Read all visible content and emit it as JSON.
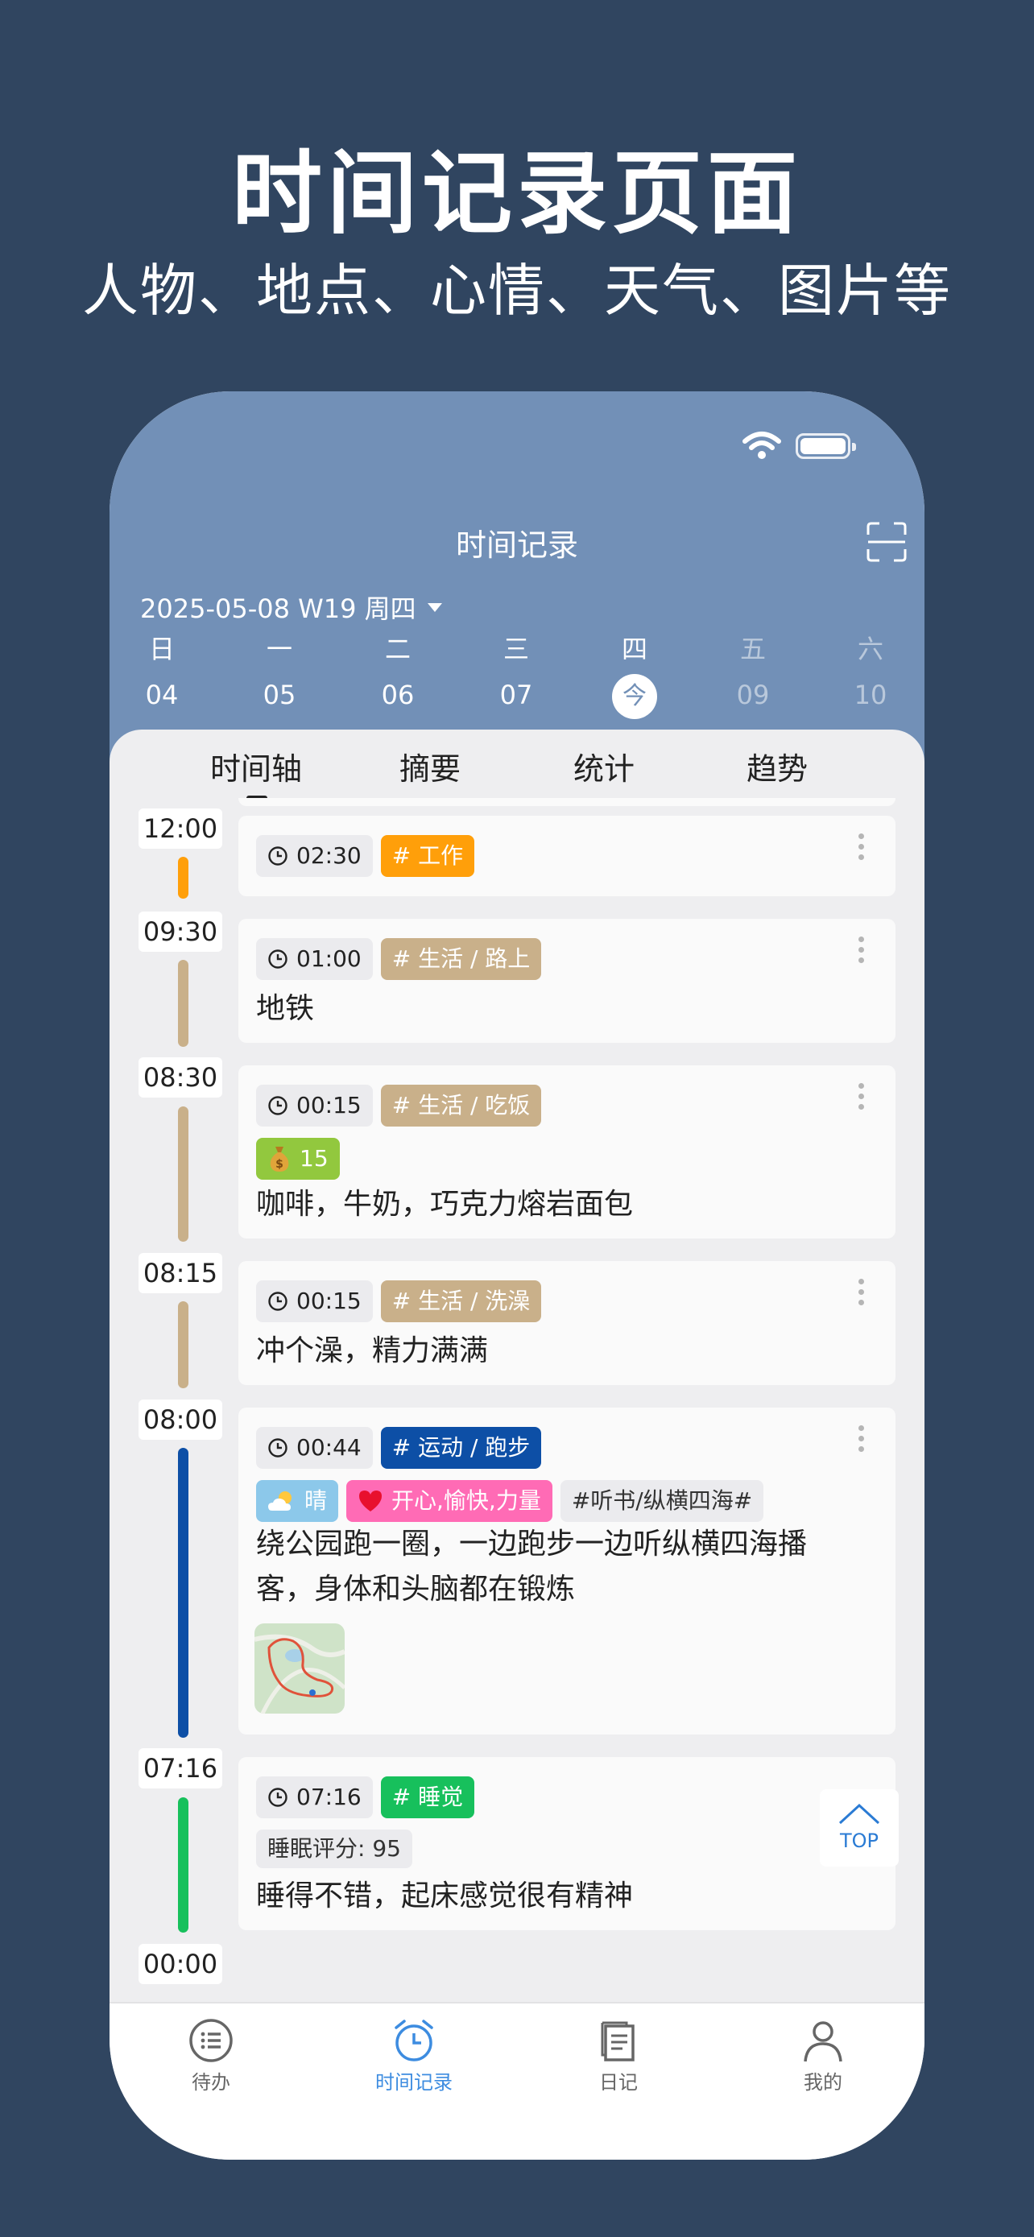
{
  "promo": {
    "title": "时间记录页面",
    "subtitle": "人物、地点、心情、天气、图片等"
  },
  "header": {
    "title": "时间记录",
    "date_selector": "2025-05-08 W19 周四"
  },
  "week": [
    {
      "weekday": "日",
      "date": "04"
    },
    {
      "weekday": "一",
      "date": "05"
    },
    {
      "weekday": "二",
      "date": "06"
    },
    {
      "weekday": "三",
      "date": "07"
    },
    {
      "weekday": "四",
      "date": "今"
    },
    {
      "weekday": "五",
      "date": "09"
    },
    {
      "weekday": "六",
      "date": "10"
    }
  ],
  "tabs": [
    "时间轴",
    "摘要",
    "统计",
    "趋势"
  ],
  "timeline": {
    "times": [
      "12:00",
      "09:30",
      "08:30",
      "08:15",
      "08:00",
      "07:16",
      "00:00"
    ],
    "entries": [
      {
        "duration": "02:30",
        "tag": "# 工作",
        "color": "#ff9f0a"
      },
      {
        "duration": "01:00",
        "tag": "# 生活 / 路上",
        "color": "#c9b08a",
        "note": "地铁"
      },
      {
        "duration": "00:15",
        "tag": "# 生活 / 吃饭",
        "color": "#c9b08a",
        "expense": "15",
        "expense_color": "#92c83e",
        "note": "咖啡，牛奶，巧克力熔岩面包"
      },
      {
        "duration": "00:15",
        "tag": "# 生活 / 洗澡",
        "color": "#c9b08a",
        "note": "冲个澡，精力满满"
      },
      {
        "duration": "00:44",
        "tag": "# 运动 / 跑步",
        "color": "#0d4fa6",
        "weather": "晴",
        "weather_color": "#8cc8ea",
        "mood": "开心,愉快,力量",
        "mood_color": "#ff6bb5",
        "topic": "#听书/纵横四海#",
        "note": "绕公园跑一圈，一边跑步一边听纵横四海播客，身体和头脑都在锻炼"
      },
      {
        "duration": "07:16",
        "tag": "# 睡觉",
        "color": "#17c05c",
        "score": "睡眠评分: 95",
        "note": "睡得不错，起床感觉很有精神"
      }
    ]
  },
  "top_button": "TOP",
  "bottom_nav": [
    {
      "label": "待办",
      "icon": "list-icon"
    },
    {
      "label": "时间记录",
      "icon": "alarm-clock-icon",
      "active": true
    },
    {
      "label": "日记",
      "icon": "diary-icon"
    },
    {
      "label": "我的",
      "icon": "person-icon"
    }
  ]
}
